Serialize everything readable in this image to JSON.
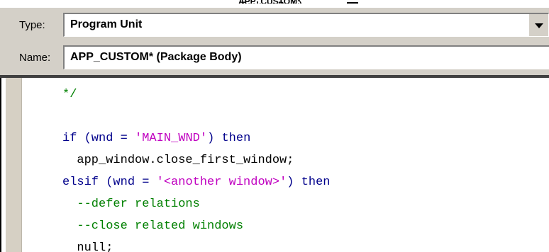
{
  "window": {
    "title_fragment": "APP_CUSTOM* (Package Body)"
  },
  "fields": {
    "type_label": "Type:",
    "type_value": "Program Unit",
    "name_label": "Name:",
    "name_value": "APP_CUSTOM* (Package Body)"
  },
  "code": {
    "lines": [
      [
        {
          "text": "*/",
          "kind": "comment"
        }
      ],
      [],
      [
        {
          "text": "if",
          "kind": "kw"
        },
        {
          "text": " (wnd = ",
          "kind": "kw"
        },
        {
          "text": "'MAIN_WND'",
          "kind": "str"
        },
        {
          "text": ") ",
          "kind": "kw"
        },
        {
          "text": "then",
          "kind": "kw"
        }
      ],
      [
        {
          "text": "  app_window.close_first_window;",
          "kind": "plain"
        }
      ],
      [
        {
          "text": "elsif",
          "kind": "kw"
        },
        {
          "text": " (wnd = ",
          "kind": "kw"
        },
        {
          "text": "'<another window>'",
          "kind": "str"
        },
        {
          "text": ") ",
          "kind": "kw"
        },
        {
          "text": "then",
          "kind": "kw"
        }
      ],
      [
        {
          "text": "  --defer relations",
          "kind": "comment"
        }
      ],
      [
        {
          "text": "  --close related windows",
          "kind": "comment"
        }
      ],
      [
        {
          "text": "  null;",
          "kind": "plain"
        }
      ]
    ]
  },
  "colors": {
    "keyword": "#00008b",
    "string": "#c000c0",
    "comment": "#008000",
    "plain": "#000000",
    "panel": "#d4d0c8"
  },
  "icons": {
    "dropdown": "chevron-down-icon"
  }
}
